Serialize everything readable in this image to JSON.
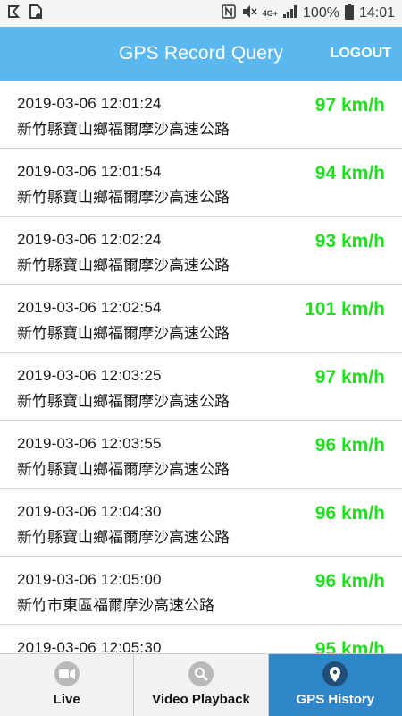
{
  "status_bar": {
    "network_type": "4G+",
    "battery": "100%",
    "time": "14:01"
  },
  "header": {
    "title": "GPS Record Query",
    "logout_label": "LOGOUT"
  },
  "records": [
    {
      "time": "2019-03-06 12:01:24",
      "address": "新竹縣寶山鄉福爾摩沙高速公路",
      "speed": "97 km/h"
    },
    {
      "time": "2019-03-06 12:01:54",
      "address": "新竹縣寶山鄉福爾摩沙高速公路",
      "speed": "94 km/h"
    },
    {
      "time": "2019-03-06 12:02:24",
      "address": "新竹縣寶山鄉福爾摩沙高速公路",
      "speed": "93 km/h"
    },
    {
      "time": "2019-03-06 12:02:54",
      "address": "新竹縣寶山鄉福爾摩沙高速公路",
      "speed": "101 km/h"
    },
    {
      "time": "2019-03-06 12:03:25",
      "address": "新竹縣寶山鄉福爾摩沙高速公路",
      "speed": "97 km/h"
    },
    {
      "time": "2019-03-06 12:03:55",
      "address": "新竹縣寶山鄉福爾摩沙高速公路",
      "speed": "96 km/h"
    },
    {
      "time": "2019-03-06 12:04:30",
      "address": "新竹縣寶山鄉福爾摩沙高速公路",
      "speed": "96 km/h"
    },
    {
      "time": "2019-03-06 12:05:00",
      "address": "新竹市東區福爾摩沙高速公路",
      "speed": "96 km/h"
    },
    {
      "time": "2019-03-06 12:05:30",
      "address": "",
      "speed": "95 km/h"
    }
  ],
  "bottom_nav": {
    "items": [
      {
        "label": "Live",
        "icon": "video-camera-icon"
      },
      {
        "label": "Video Playback",
        "icon": "search-icon"
      },
      {
        "label": "GPS History",
        "icon": "location-pin-icon"
      }
    ],
    "active": "GPS History"
  },
  "colors": {
    "header_bg": "#5bb8ef",
    "speed_text": "#22dd22",
    "active_tab_bg": "#2f86c8"
  }
}
